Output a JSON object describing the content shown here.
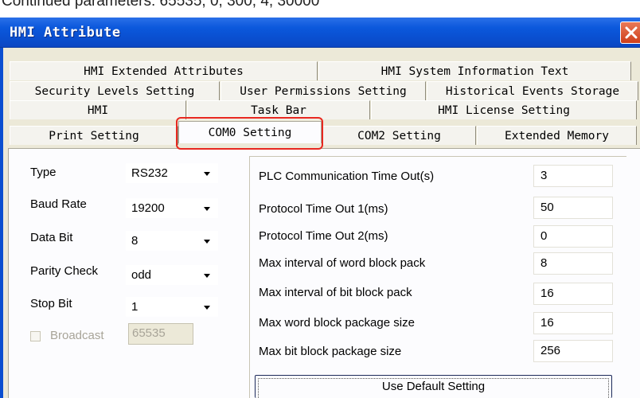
{
  "top_strip_text": "Continued parameters: 65535, 0, 300, 4, 30000",
  "dialog": {
    "title": "HMI Attribute"
  },
  "tabs": {
    "row1": [
      "HMI Extended Attributes",
      "HMI System Information Text"
    ],
    "row2": [
      "Security Levels Setting",
      "User Permissions Setting",
      "Historical Events Storage"
    ],
    "row3": [
      "HMI",
      "Task Bar",
      "HMI License Setting"
    ],
    "row4": [
      "Print Setting",
      "COM0 Setting",
      "COM2 Setting",
      "Extended Memory"
    ],
    "selected": "COM0 Setting"
  },
  "serial": {
    "type_label": "Type",
    "type_value": "RS232",
    "baud_label": "Baud Rate",
    "baud_value": "19200",
    "databit_label": "Data Bit",
    "databit_value": "8",
    "parity_label": "Parity Check",
    "parity_value": "odd",
    "stopbit_label": "Stop Bit",
    "stopbit_value": "1",
    "broadcast_label": "Broadcast",
    "broadcast_value": "65535",
    "broadcast_checked": false
  },
  "comm": {
    "params": [
      {
        "label": "PLC Communication Time Out(s)",
        "value": "3"
      },
      {
        "label": "Protocol Time Out 1(ms)",
        "value": "50"
      },
      {
        "label": "Protocol Time Out 2(ms)",
        "value": "0"
      },
      {
        "label": "Max interval of word block pack",
        "value": "8"
      },
      {
        "label": "Max interval of bit block pack",
        "value": "16"
      },
      {
        "label": "Max word block package size",
        "value": "16"
      },
      {
        "label": "Max bit block package size",
        "value": "256"
      }
    ],
    "default_button": "Use Default Setting"
  },
  "colors": {
    "titlebar": "#0b58dc",
    "highlight": "#e8281f",
    "dialog_bg": "#ece9d8"
  },
  "icons": {
    "close": "close-icon",
    "dropdown": "dropdown-arrow-icon"
  }
}
